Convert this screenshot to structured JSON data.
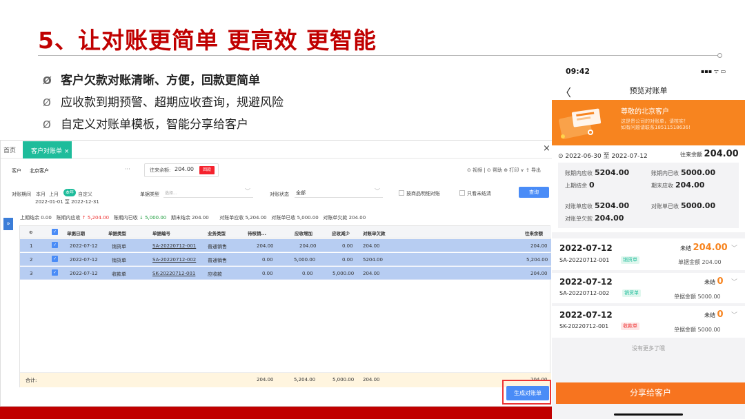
{
  "slide": {
    "title": "5、让对账更简单  更高效  更智能",
    "bullet_marker": "Ø",
    "bullets": [
      "客户欠款对账清晰、方便，回款更简单",
      "应收款到期预警、超期应收查询，规避风险",
      "自定义对账单模板，智能分享给客户"
    ],
    "accent_color": "#c00000"
  },
  "app": {
    "tabs": {
      "home": "首页",
      "active": "客户对账单",
      "active_close": "×",
      "close_all": "×"
    },
    "customer_label": "客户",
    "customer_value": "北京客户",
    "customer_more": "···",
    "balance_label": "往来余额:",
    "balance_value": "204.00",
    "balance_button": "回款",
    "toolbar_right": "⊙ 视频 | ⊙ 帮助  ⊕ 打印 ∨  ⇪ 导出",
    "period_label": "对账期间",
    "period_options": [
      "本月",
      "上月",
      "本年",
      "自定义"
    ],
    "date_from": "2022-01-01",
    "date_sep": "至",
    "date_to": "2022-12-31",
    "doctype_label": "单据类型",
    "doctype_placeholder": "选择...",
    "status_label": "对账状态",
    "status_value": "全部",
    "chk1_label": "按商品明细对账",
    "chk2_label": "只看未结清",
    "query_button": "查询",
    "summary": {
      "opening_label": "上期结余",
      "opening": "0.00",
      "in_recv_label": "账期内应收",
      "in_recv": "5,204.00",
      "in_paid_label": "账期内已收",
      "in_paid": "5,000.00",
      "closing_label": "期末结余",
      "closing": "204.00",
      "st_recv_label": "对账单应收",
      "st_recv": "5,204.00",
      "st_paid_label": "对账单已收",
      "st_paid": "5,000.00",
      "st_owe_label": "对账单欠款",
      "st_owe": "204.00"
    },
    "side_toggle": "»",
    "columns": [
      "⊙",
      "",
      "单据日期",
      "单据类型",
      "单据编号",
      "业务类型",
      "待核销...",
      "应收增加",
      "应收减少",
      "对账单欠款",
      "往来余额"
    ],
    "rows": [
      {
        "idx": "1",
        "date": "2022-07-12",
        "type": "销货单",
        "no": "SA-20220712-001",
        "biz": "普通销售",
        "pending": "204.00",
        "inc": "204.00",
        "dec": "0.00",
        "owe": "204.00",
        "balance": "204.00"
      },
      {
        "idx": "2",
        "date": "2022-07-12",
        "type": "销货单",
        "no": "SA-20220712-002",
        "biz": "普通销售",
        "pending": "0.00",
        "inc": "5,000.00",
        "dec": "0.00",
        "owe": "5204.00",
        "balance": "5,204.00"
      },
      {
        "idx": "3",
        "date": "2022-07-12",
        "type": "收款单",
        "no": "SK-20220712-001",
        "biz": "应收款",
        "pending": "0.00",
        "inc": "0.00",
        "dec": "5,000.00",
        "owe": "204.00",
        "balance": "204.00"
      }
    ],
    "total": {
      "label": "合计:",
      "pending": "204.00",
      "inc": "5,204.00",
      "dec": "5,000.00",
      "owe": "204.00",
      "balance": "204.00"
    },
    "generate_button": "生成对账单"
  },
  "phone": {
    "time": "09:42",
    "status_icons": "▪▪▪ ᯤ ▭",
    "back": "〈",
    "nav_title": "预览对账单",
    "greeting": "尊敬的北京客户",
    "sub1": "这是贵公司的对账单，请核实！",
    "sub2": "如有问题请联系18511518636!",
    "range": "2022-06-30 至 2022-07-12",
    "balance_label": "往来余额",
    "balance": "204.00",
    "stats": [
      {
        "label": "账期内应收",
        "value": "5204.00"
      },
      {
        "label": "账期内已收",
        "value": "5000.00"
      },
      {
        "label": "上期结余",
        "value": "0"
      },
      {
        "label": "期末应收",
        "value": "204.00"
      },
      {
        "label": "对账单应收",
        "value": "5204.00"
      },
      {
        "label": "对账单已收",
        "value": "5000.00"
      },
      {
        "label": "对账单欠款",
        "value": "204.00"
      }
    ],
    "cards": [
      {
        "date": "2022-07-12",
        "status": "未结",
        "amount": "204.00",
        "no": "SA-20220712-001",
        "tag": "销货单",
        "total_label": "单据金额",
        "total": "204.00"
      },
      {
        "date": "2022-07-12",
        "status": "未结",
        "amount": "0",
        "no": "SA-20220712-002",
        "tag": "销货单",
        "total_label": "单据金额",
        "total": "5000.00"
      },
      {
        "date": "2022-07-12",
        "status": "未结",
        "amount": "0",
        "no": "SK-20220712-001",
        "tag": "收款单",
        "total_label": "单据金额",
        "total": "5000.00"
      }
    ],
    "no_more": "没有更多了哦",
    "share_button": "分享给客户"
  }
}
